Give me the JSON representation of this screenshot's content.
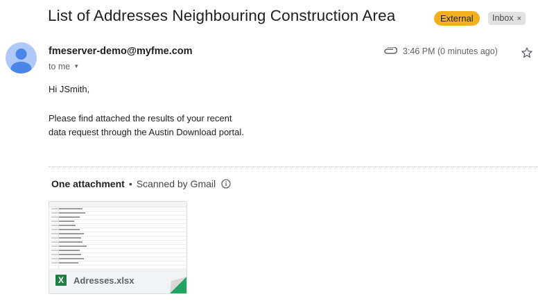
{
  "email": {
    "subject": "List of Addresses Neighbouring Construction Area",
    "labels": {
      "external": "External",
      "inbox": "Inbox",
      "remove_symbol": "×"
    },
    "sender": "fmeserver-demo@myfme.com",
    "recipient": "to me",
    "timestamp": "3:46 PM (0 minutes ago)",
    "greeting": "Hi JSmith,",
    "body_lines": [
      "Please find attached the results of your recent",
      "data request through the Austin Download portal."
    ]
  },
  "attachments": {
    "count_label": "One attachment",
    "separator": "•",
    "scan_label": "Scanned by Gmail",
    "items": [
      {
        "filename": "Adresses.xlsx",
        "type_icon": "excel-icon",
        "type_letter": "X"
      }
    ]
  },
  "icons": {
    "paperclip": "paperclip-icon",
    "star": "star-icon",
    "info": "info-icon",
    "avatar": "default-avatar-icon"
  },
  "colors": {
    "external_badge": "#f2b01e",
    "inbox_badge": "#e2e2e2",
    "avatar_bg": "#aec8f7",
    "avatar_fg": "#4a86e8",
    "excel_green": "#1e7e45",
    "fold_green": "#1fa463"
  }
}
